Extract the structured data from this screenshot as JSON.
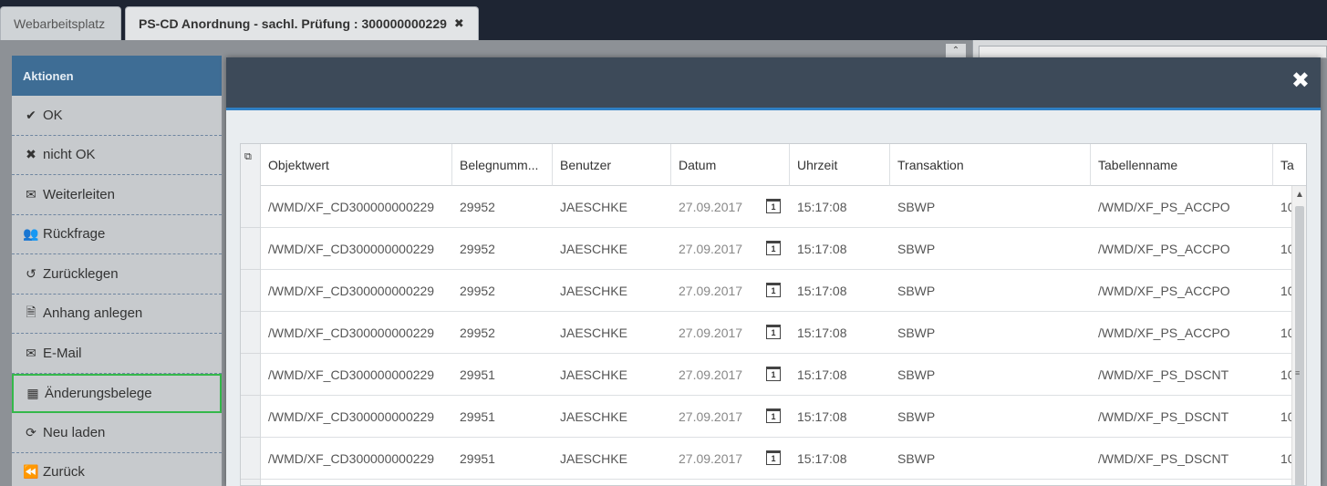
{
  "tabs": [
    {
      "label": "Webarbeitsplatz",
      "active": false
    },
    {
      "label": "PS-CD Anordnung - sachl. Prüfung : 300000000229",
      "active": true
    }
  ],
  "sidebar": {
    "title": "Aktionen",
    "items": [
      {
        "label": "OK",
        "icon": "check-icon"
      },
      {
        "label": "nicht OK",
        "icon": "close-icon"
      },
      {
        "label": "Weiterleiten",
        "icon": "envelope-icon"
      },
      {
        "label": "Rückfrage",
        "icon": "users-icon"
      },
      {
        "label": "Zurücklegen",
        "icon": "undo-icon"
      },
      {
        "label": "Anhang anlegen",
        "icon": "file-pdf-icon"
      },
      {
        "label": "E-Mail",
        "icon": "envelope-icon"
      },
      {
        "label": "Änderungsbelege",
        "icon": "table-icon",
        "selected": true
      },
      {
        "label": "Neu laden",
        "icon": "refresh-icon"
      },
      {
        "label": "Zurück",
        "icon": "backward-icon"
      }
    ]
  },
  "modal": {
    "close_label": "✖",
    "columns": [
      "Objektwert",
      "Belegnumm...",
      "Benutzer",
      "Datum",
      "Uhrzeit",
      "Transaktion",
      "Tabellenname",
      "Ta"
    ],
    "rows": [
      [
        "/WMD/XF_CD300000000229",
        "29952",
        "JAESCHKE",
        "27.09.2017",
        "15:17:08",
        "SBWP",
        "/WMD/XF_PS_ACCPO",
        "10"
      ],
      [
        "/WMD/XF_CD300000000229",
        "29952",
        "JAESCHKE",
        "27.09.2017",
        "15:17:08",
        "SBWP",
        "/WMD/XF_PS_ACCPO",
        "10"
      ],
      [
        "/WMD/XF_CD300000000229",
        "29952",
        "JAESCHKE",
        "27.09.2017",
        "15:17:08",
        "SBWP",
        "/WMD/XF_PS_ACCPO",
        "10"
      ],
      [
        "/WMD/XF_CD300000000229",
        "29952",
        "JAESCHKE",
        "27.09.2017",
        "15:17:08",
        "SBWP",
        "/WMD/XF_PS_ACCPO",
        "10"
      ],
      [
        "/WMD/XF_CD300000000229",
        "29951",
        "JAESCHKE",
        "27.09.2017",
        "15:17:08",
        "SBWP",
        "/WMD/XF_PS_DSCNT",
        "10"
      ],
      [
        "/WMD/XF_CD300000000229",
        "29951",
        "JAESCHKE",
        "27.09.2017",
        "15:17:08",
        "SBWP",
        "/WMD/XF_PS_DSCNT",
        "10"
      ],
      [
        "/WMD/XF_CD300000000229",
        "29951",
        "JAESCHKE",
        "27.09.2017",
        "15:17:08",
        "SBWP",
        "/WMD/XF_PS_DSCNT",
        "10"
      ]
    ]
  },
  "colors": {
    "sidebar_header": "#3e6d95",
    "modal_header": "#3d4a59",
    "modal_accent": "#2f7fc4",
    "selected_border": "#34b84a"
  }
}
